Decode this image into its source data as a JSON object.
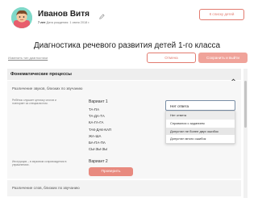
{
  "header": {
    "child_name": "Иванов Витя",
    "age_value": "7 лет",
    "meta_text": "Дата рождения: 1 июня 2018 г.",
    "back_label": "К списку детей"
  },
  "page_title": "Диагностика речевого развития детей 1-го класса",
  "actions": {
    "change_link": "Изменить тип диагностики",
    "cancel_label": "Отмена",
    "save_exit_label": "Сохранить и выйти"
  },
  "section": {
    "title": "Фонематические процессы",
    "subsection_title": "Различение звуков, близких по звучанию",
    "instruction_1": "Ребёнок слушает цепочку слогов и повторяет за специалистом.",
    "variant_1_label": "Вариант 1",
    "syllables": [
      "ТА-ПА",
      "ТА-ДА-ТА",
      "КА-ГА-ГА",
      "ТАК-ДАК-КАП",
      "ЖА-ША",
      "БА-ПА-ПА",
      "СЫ-ЗЫ-ЗЫ"
    ],
    "instruction_2": "Инструкция – в звуковом сопровождении в упражнениях.",
    "variant_2_label": "Вариант 2",
    "check_label": "Проверить",
    "next_section_title": "Различение слов, близких по звучанию"
  },
  "select": {
    "value": "Нет ответа",
    "options": [
      "Нет ответа",
      "Справился с заданием",
      "Допустил не более двух ошибок",
      "Допустил много ошибок"
    ]
  }
}
